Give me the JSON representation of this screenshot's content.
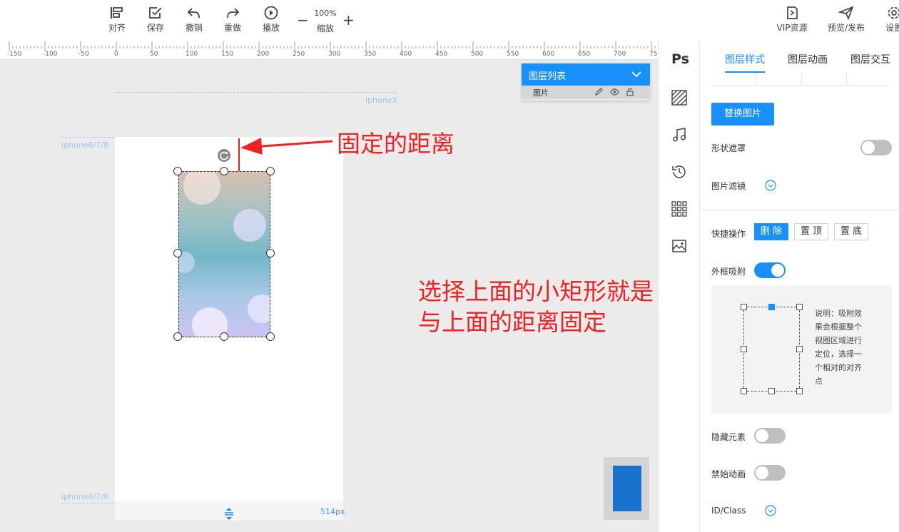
{
  "toolbar": {
    "align": "对齐",
    "save": "保存",
    "undo": "撤销",
    "redo": "重做",
    "play": "播放",
    "zoom_value": "100%",
    "zoom_label": "缩放",
    "zoom_minus": "−",
    "zoom_plus": "+",
    "vip": "VIP资源",
    "publish": "预览/发布",
    "settings": "设置"
  },
  "ruler": {
    "ticks": [
      "-150",
      "-100",
      "-50",
      "0",
      "50",
      "100",
      "150",
      "200",
      "250",
      "300",
      "350",
      "400",
      "450",
      "500",
      "550",
      "600",
      "650",
      "700",
      "75"
    ]
  },
  "canvas": {
    "guide_iphonex": "iphoneX",
    "guide_top": "iphone6/7/8",
    "guide_bottom": "iphone6/7/8",
    "artboard_size": "514px"
  },
  "layers": {
    "title": "图层列表",
    "item": "图片"
  },
  "annotations": {
    "fixed_distance": "固定的距离",
    "note_line1": "选择上面的小矩形就是",
    "note_line2": "与上面的距离固定"
  },
  "side_icons": {
    "ps": "Ps"
  },
  "panel": {
    "tabs": [
      "图层样式",
      "图层动画",
      "图层交互"
    ],
    "replace_image": "替换图片",
    "shape_mask": "形状遮罩",
    "image_filter": "图片滤镜",
    "quick_actions": "快捷操作",
    "qa_delete": "删 除",
    "qa_top": "置 顶",
    "qa_bottom": "置 底",
    "snap_frame": "外框吸附",
    "anchor_description": "说明：吸附效果会根据整个视图区域进行定位，选择一个相对的对齐点",
    "hide_element": "隐藏元素",
    "disable_animation": "禁始动画",
    "id_class": "ID/Class"
  },
  "toggles": {
    "shape_mask": false,
    "snap_frame": true,
    "hide_element": false,
    "disable_animation": false
  },
  "colors": {
    "accent": "#1890ff",
    "annotation": "#ee2222"
  }
}
